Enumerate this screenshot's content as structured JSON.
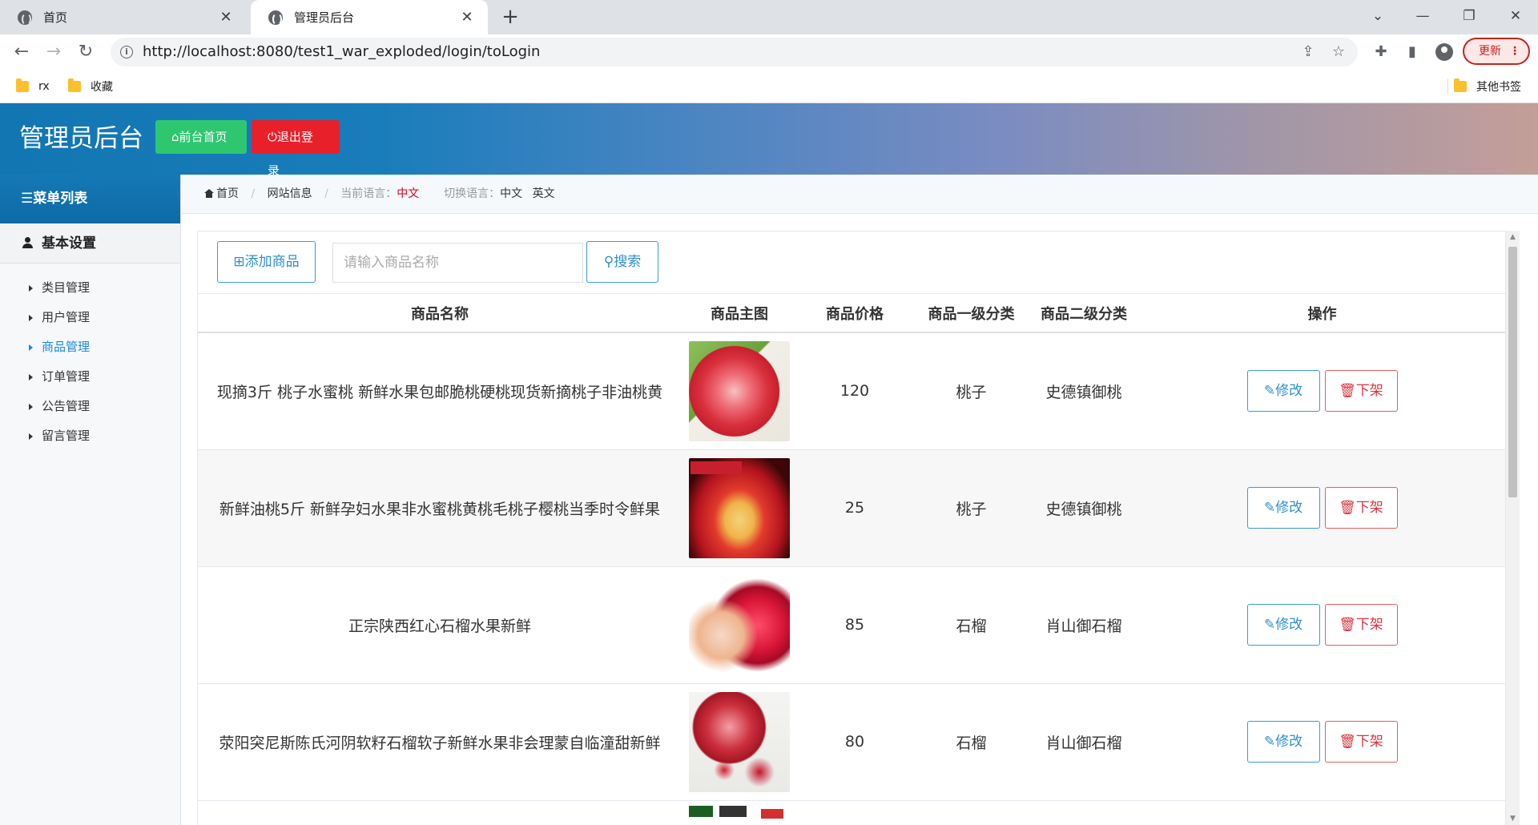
{
  "browser": {
    "tabs": [
      {
        "title": "首页",
        "active": false
      },
      {
        "title": "管理员后台",
        "active": true
      }
    ],
    "new_tab": "+",
    "url": "http://localhost:8080/test1_war_exploded/login/toLogin",
    "update_label": "更新",
    "bookmarks": [
      "rx",
      "收藏"
    ],
    "other_bookmarks": "其他书签"
  },
  "header": {
    "title": "管理员后台",
    "home_button": "前台首页",
    "logout_button": "退出登录",
    "colors": {
      "home": "#2ec770",
      "logout": "#e8202a"
    }
  },
  "sidebar": {
    "menu_title": "菜单列表",
    "group": "基本设置",
    "items": [
      {
        "label": "类目管理",
        "active": false
      },
      {
        "label": "用户管理",
        "active": false
      },
      {
        "label": "商品管理",
        "active": true
      },
      {
        "label": "订单管理",
        "active": false
      },
      {
        "label": "公告管理",
        "active": false
      },
      {
        "label": "留言管理",
        "active": false
      }
    ]
  },
  "breadcrumb": {
    "home": "首页",
    "site_info": "网站信息",
    "current_lang_label": "当前语言：",
    "current_lang": "中文",
    "switch_label": "切换语言：",
    "lang_zh": "中文",
    "lang_en": "英文"
  },
  "toolbar": {
    "add_button": "添加商品",
    "search_placeholder": "请输入商品名称",
    "search_button": "搜索"
  },
  "table": {
    "columns": [
      "商品名称",
      "商品主图",
      "商品价格",
      "商品一级分类",
      "商品二级分类",
      "操作"
    ],
    "rows": [
      {
        "name": "现摘3斤 桃子水蜜桃 新鲜水果包邮脆桃硬桃现货新摘桃子非油桃黄",
        "price": "120",
        "cat1": "桃子",
        "cat2": "史德镇御桃"
      },
      {
        "name": "新鲜油桃5斤 新鲜孕妇水果非水蜜桃黄桃毛桃子樱桃当季时令鲜果",
        "price": "25",
        "cat1": "桃子",
        "cat2": "史德镇御桃"
      },
      {
        "name": "正宗陕西红心石榴水果新鲜",
        "price": "85",
        "cat1": "石榴",
        "cat2": "肖山御石榴"
      },
      {
        "name": "荥阳突尼斯陈氏河阴软籽石榴软子新鲜水果非会理蒙自临潼甜新鲜",
        "price": "80",
        "cat1": "石榴",
        "cat2": "肖山御石榴"
      }
    ],
    "edit_label": "修改",
    "remove_label": "下架"
  }
}
